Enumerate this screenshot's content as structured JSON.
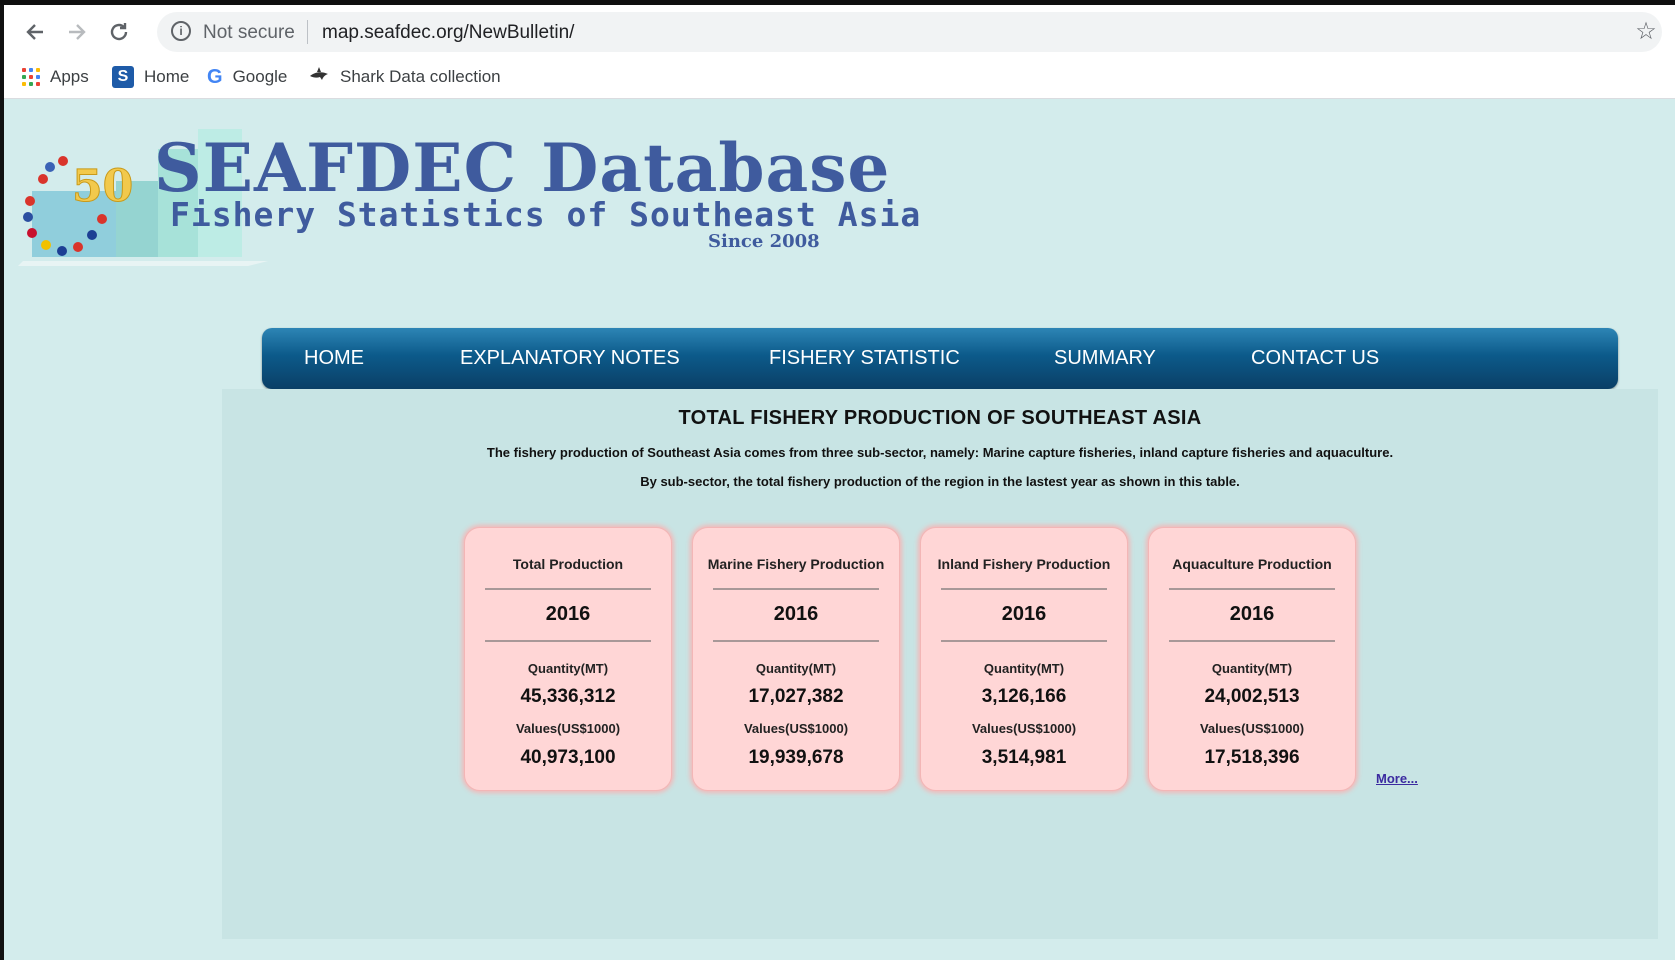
{
  "browser": {
    "security_label": "Not secure",
    "url": "map.seafdec.org/NewBulletin/",
    "bookmarks": [
      {
        "label": "Apps",
        "icon": "apps-grid-icon"
      },
      {
        "label": "Home",
        "icon": "seafdec-home-icon"
      },
      {
        "label": "Google",
        "icon": "google-icon"
      },
      {
        "label": "Shark Data collection",
        "icon": "shark-icon"
      }
    ]
  },
  "header": {
    "logo_badge": "50",
    "title": "SEAFDEC Database",
    "subtitle": "Fishery Statistics of Southeast Asia",
    "since": "Since 2008"
  },
  "menu": [
    "HOME",
    "EXPLANATORY NOTES",
    "FISHERY STATISTIC",
    "SUMMARY",
    "CONTACT US"
  ],
  "content": {
    "title": "TOTAL FISHERY PRODUCTION OF SOUTHEAST ASIA",
    "desc1": "The fishery production of Southeast Asia comes from three sub-sector, namely: Marine capture fisheries, inland capture fisheries and aquaculture.",
    "desc2": "By sub-sector, the total fishery production of the region in the lastest year as shown in this table.",
    "more_link": "More...",
    "quantity_label": "Quantity(MT)",
    "values_label": "Values(US$1000)",
    "cards": [
      {
        "title": "Total Production",
        "year": "2016",
        "quantity": "45,336,312",
        "value": "40,973,100"
      },
      {
        "title": "Marine Fishery Production",
        "year": "2016",
        "quantity": "17,027,382",
        "value": "19,939,678"
      },
      {
        "title": "Inland Fishery Production",
        "year": "2016",
        "quantity": "3,126,166",
        "value": "3,514,981"
      },
      {
        "title": "Aquaculture Production",
        "year": "2016",
        "quantity": "24,002,513",
        "value": "17,518,396"
      }
    ]
  },
  "colors": {
    "page_bg": "#d3ecec",
    "content_bg": "#c8e4e4",
    "menu_blue": "#0c5a8a",
    "card_pink": "#ffd6d6",
    "logo_blue": "#3f5b9e"
  }
}
